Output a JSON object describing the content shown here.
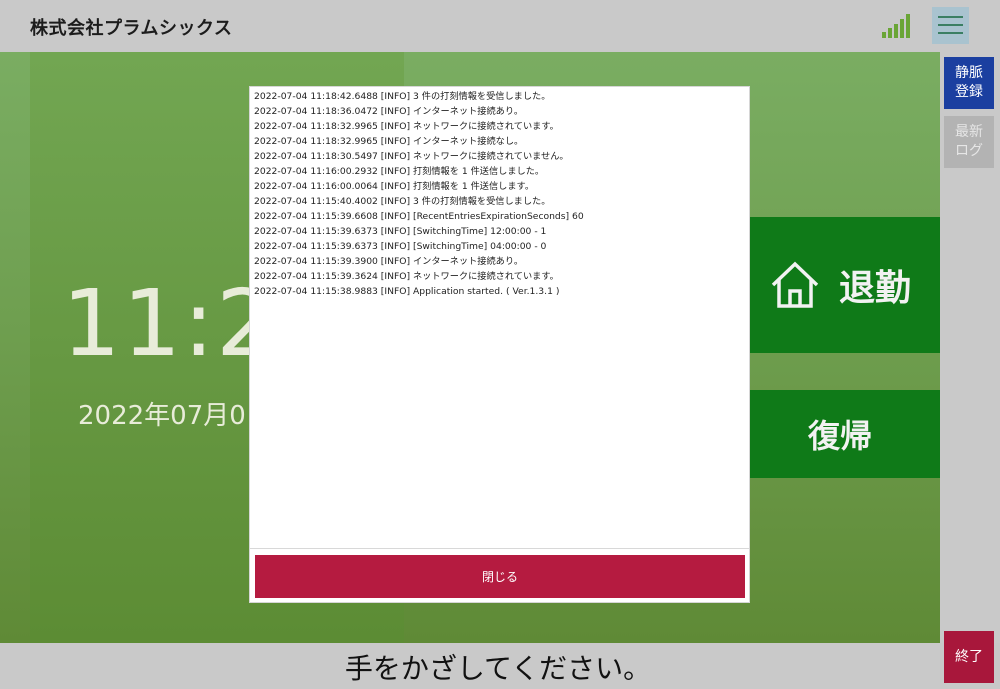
{
  "header": {
    "company": "株式会社プラムシックス",
    "signal_icon": "signal-strength-icon",
    "menu_icon": "hamburger-menu-icon"
  },
  "main": {
    "clock": "11:2",
    "date": "2022年07月0",
    "buttons": {
      "taikin": "退勤",
      "taikin_icon": "home-icon",
      "fukki": "復帰"
    }
  },
  "sidebar": {
    "vein_register": "静脈\n登録",
    "latest_log": "最新\nログ",
    "exit": "終了"
  },
  "footer": {
    "prompt": "手をかざしてください。"
  },
  "dialog": {
    "log_lines": [
      "2022-07-04 11:18:42.6488 [INFO] 3 件の打刻情報を受信しました。",
      "2022-07-04 11:18:36.0472 [INFO] インターネット接続あり。",
      "2022-07-04 11:18:32.9965 [INFO] ネットワークに接続されています。",
      "2022-07-04 11:18:32.9965 [INFO] インターネット接続なし。",
      "2022-07-04 11:18:30.5497 [INFO] ネットワークに接続されていません。",
      "2022-07-04 11:16:00.2932 [INFO] 打刻情報を 1 件送信しました。",
      "2022-07-04 11:16:00.0064 [INFO] 打刻情報を 1 件送信します。",
      "2022-07-04 11:15:40.4002 [INFO] 3 件の打刻情報を受信しました。",
      "2022-07-04 11:15:39.6608 [INFO] [RecentEntriesExpirationSeconds] 60",
      "2022-07-04 11:15:39.6373 [INFO] [SwitchingTime] 12:00:00 - 1",
      "2022-07-04 11:15:39.6373 [INFO] [SwitchingTime] 04:00:00 - 0",
      "2022-07-04 11:15:39.3900 [INFO] インターネット接続あり。",
      "2022-07-04 11:15:39.3624 [INFO] ネットワークに接続されています。",
      "2022-07-04 11:15:38.9883 [INFO] Application started. ( Ver.1.3.1 )"
    ],
    "close_label": "閉じる"
  },
  "colors": {
    "accent_green": "#0f7a18",
    "panel_green": "#6f9f50",
    "close_red": "#b51b40",
    "vein_blue": "#1b3fa0",
    "exit_red": "#a8173b"
  }
}
